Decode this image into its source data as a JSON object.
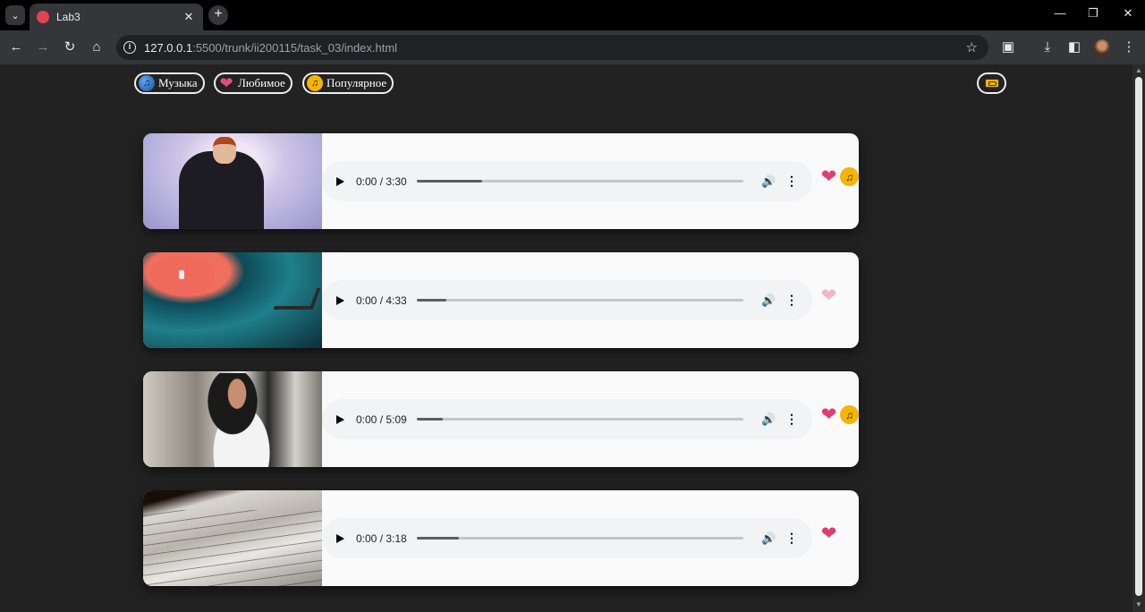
{
  "browser": {
    "tab_title": "Lab3",
    "url_host": "127.0.0.1",
    "url_path": ":5500/trunk/ii200115/task_03/index.html",
    "icons": {
      "tab_search": "chevron-down-icon",
      "new_tab": "plus-icon",
      "back": "arrow-left-icon",
      "forward": "arrow-right-icon",
      "reload": "reload-icon",
      "home": "home-icon",
      "bookmark": "star-icon",
      "extensions": "puzzle-icon",
      "downloads": "download-icon",
      "side_panel": "side-panel-icon",
      "menu": "kebab-icon"
    }
  },
  "nav": {
    "items": [
      {
        "label": "Музыка",
        "icon": "music-icon"
      },
      {
        "label": "Любимое",
        "icon": "heart-icon"
      },
      {
        "label": "Популярное",
        "icon": "note-icon"
      }
    ],
    "cassette_icon": "cassette-icon"
  },
  "tracks": [
    {
      "time": "0:00 / 3:30",
      "progress": 0.2,
      "cover": "man-singing-microphone",
      "tags": [
        "favorite",
        "popular"
      ]
    },
    {
      "time": "0:00 / 4:33",
      "progress": 0.09,
      "cover": "vinyl-record-player",
      "tags": [
        "favorite-faded"
      ]
    },
    {
      "time": "0:00 / 5:09",
      "progress": 0.08,
      "cover": "woman-with-hat",
      "tags": [
        "favorite",
        "popular"
      ]
    },
    {
      "time": "0:00 / 3:18",
      "progress": 0.13,
      "cover": "sheet-music-book",
      "tags": [
        "favorite"
      ]
    }
  ],
  "colors": {
    "page_bg": "#222222",
    "card_bg": "#fafafa",
    "heart": "#e23b73",
    "note": "#f5b400"
  }
}
